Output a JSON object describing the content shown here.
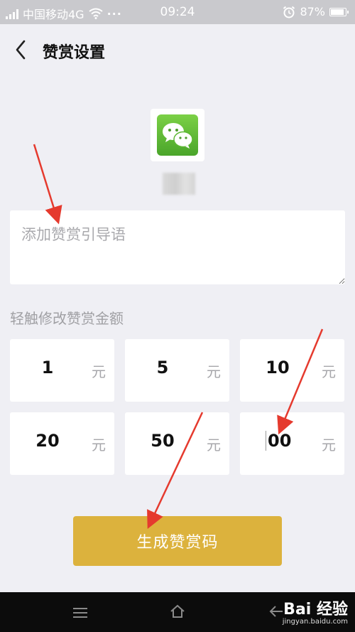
{
  "status_bar": {
    "carrier": "中国移动4G",
    "dots": "···",
    "time": "09:24",
    "battery": "87%"
  },
  "header": {
    "title": "赞赏设置"
  },
  "guide_input": {
    "placeholder": "添加赞赏引导语",
    "value": ""
  },
  "hint": "轻触修改赞赏金额",
  "amounts": [
    {
      "value": "1",
      "unit": "元"
    },
    {
      "value": "5",
      "unit": "元"
    },
    {
      "value": "10",
      "unit": "元"
    },
    {
      "value": "20",
      "unit": "元"
    },
    {
      "value": "50",
      "unit": "元"
    },
    {
      "value": "00",
      "unit": "元"
    }
  ],
  "generate_button": "生成赞赏码",
  "watermark": {
    "brand": "Bai 经验",
    "url": "jingyan.baidu.com"
  },
  "colors": {
    "background": "#efeff4",
    "button": "#dcb23d",
    "arrow": "#e53a2e",
    "logo_green": "#5cb833"
  },
  "icons": [
    "back-chevron-icon",
    "wifi-icon",
    "alarm-icon",
    "battery-icon",
    "wechat-logo",
    "menu-icon",
    "home-icon",
    "back-icon"
  ]
}
